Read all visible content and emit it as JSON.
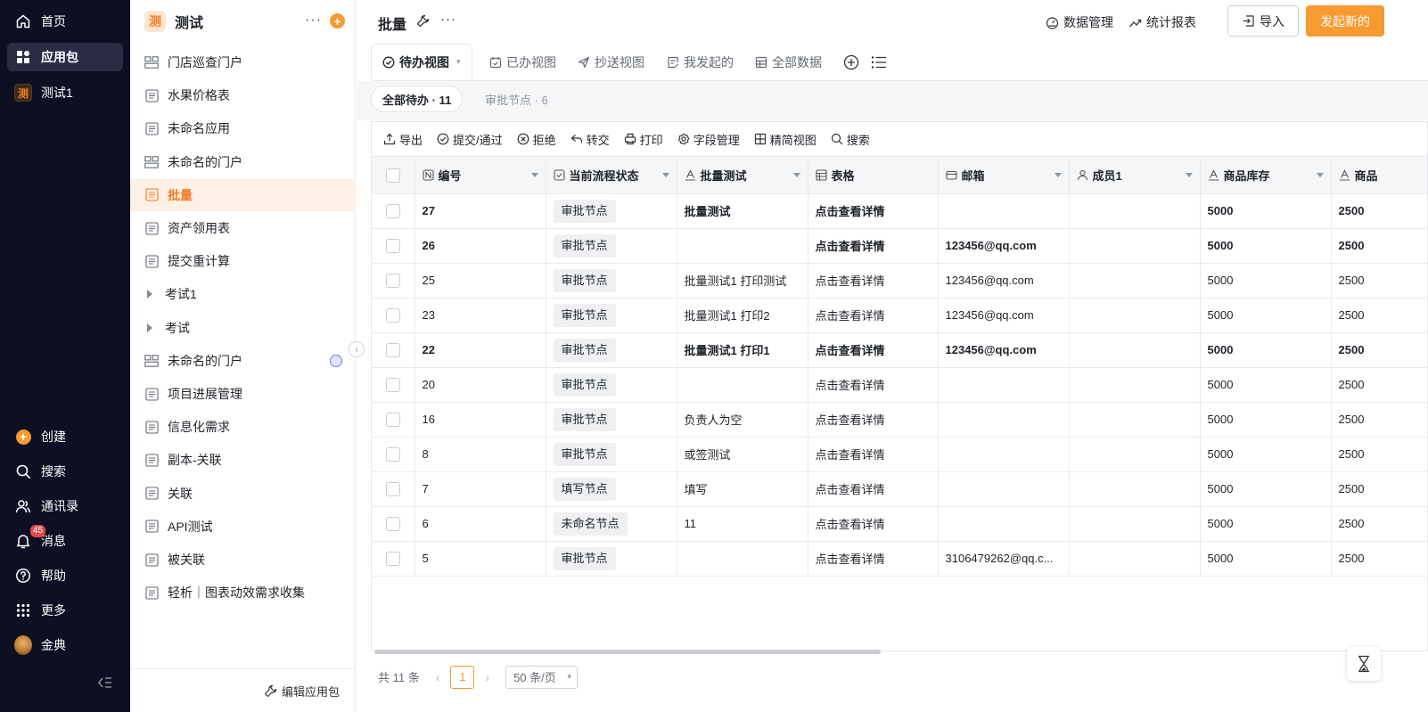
{
  "nav": {
    "top_items": [
      {
        "label": "首页",
        "icon": "home-icon"
      },
      {
        "label": "应用包",
        "icon": "grid-icon",
        "active": true
      },
      {
        "label": "测试1",
        "icon": "app-badge-icon",
        "badge_char": "测"
      }
    ],
    "bottom_items": [
      {
        "label": "创建",
        "icon": "plus-circle-icon"
      },
      {
        "label": "搜索",
        "icon": "search-icon"
      },
      {
        "label": "通讯录",
        "icon": "contacts-icon"
      },
      {
        "label": "消息",
        "icon": "bell-icon",
        "badge": "45"
      },
      {
        "label": "帮助",
        "icon": "help-icon"
      },
      {
        "label": "更多",
        "icon": "dots-grid-icon"
      },
      {
        "label": "金典",
        "icon": "avatar"
      }
    ]
  },
  "sidebar": {
    "logo_char": "测",
    "title": "测试",
    "more": "···",
    "plus": "+",
    "items": [
      {
        "label": "门店巡查门户",
        "icon": "portal-icon"
      },
      {
        "label": "水果价格表",
        "icon": "form-icon"
      },
      {
        "label": "未命名应用",
        "icon": "form-icon"
      },
      {
        "label": "未命名的门户",
        "icon": "portal-icon"
      },
      {
        "label": "批量",
        "icon": "form-icon",
        "active": true
      },
      {
        "label": "资产领用表",
        "icon": "form-icon"
      },
      {
        "label": "提交重计算",
        "icon": "form-icon"
      },
      {
        "label": "考试1",
        "icon": "folder-caret-icon"
      },
      {
        "label": "考试",
        "icon": "folder-caret-icon"
      },
      {
        "label": "未命名的门户",
        "icon": "portal-icon",
        "globe": true
      },
      {
        "label": "项目进展管理",
        "icon": "form-icon"
      },
      {
        "label": "信息化需求",
        "icon": "form-icon"
      },
      {
        "label": "副本-关联",
        "icon": "form-icon"
      },
      {
        "label": "关联",
        "icon": "form-icon"
      },
      {
        "label": "API测试",
        "icon": "form-icon"
      },
      {
        "label": "被关联",
        "icon": "form-icon"
      },
      {
        "label": "轻析｜图表动效需求收集",
        "icon": "form-icon"
      }
    ],
    "footer_label": "编辑应用包"
  },
  "header": {
    "title": "批量",
    "data_manage": "数据管理",
    "stats_report": "统计报表",
    "import_label": "导入",
    "new_label": "发起新的"
  },
  "view_tabs": [
    {
      "label": "待办视图",
      "active": true
    },
    {
      "label": "已办视图"
    },
    {
      "label": "抄送视图"
    },
    {
      "label": "我发起的"
    },
    {
      "label": "全部数据"
    }
  ],
  "sub_tabs": [
    {
      "label": "全部待办 · 11",
      "active": true
    },
    {
      "label": "审批节点 · 6"
    }
  ],
  "toolbar": [
    "导出",
    "提交/通过",
    "拒绝",
    "转交",
    "打印",
    "字段管理",
    "精简视图",
    "搜索"
  ],
  "table": {
    "columns": [
      "编号",
      "当前流程状态",
      "批量测试",
      "表格",
      "邮箱",
      "成员1",
      "商品库存",
      "商品"
    ],
    "rows": [
      {
        "bold": true,
        "cells": [
          "27",
          "审批节点",
          "批量测试",
          "点击查看详情",
          "",
          "",
          "5000",
          "2500"
        ]
      },
      {
        "bold": true,
        "cells": [
          "26",
          "审批节点",
          "",
          "点击查看详情",
          "123456@qq.com",
          "",
          "5000",
          "2500"
        ]
      },
      {
        "bold": false,
        "cells": [
          "25",
          "审批节点",
          "批量测试1 打印测试",
          "点击查看详情",
          "123456@qq.com",
          "",
          "5000",
          "2500"
        ]
      },
      {
        "bold": false,
        "cells": [
          "23",
          "审批节点",
          "批量测试1 打印2",
          "点击查看详情",
          "123456@qq.com",
          "",
          "5000",
          "2500"
        ]
      },
      {
        "bold": true,
        "cells": [
          "22",
          "审批节点",
          "批量测试1 打印1",
          "点击查看详情",
          "123456@qq.com",
          "",
          "5000",
          "2500"
        ]
      },
      {
        "bold": false,
        "cells": [
          "20",
          "审批节点",
          "",
          "点击查看详情",
          "",
          "",
          "5000",
          "2500"
        ]
      },
      {
        "bold": false,
        "cells": [
          "16",
          "审批节点",
          "负责人为空",
          "点击查看详情",
          "",
          "",
          "5000",
          "2500"
        ]
      },
      {
        "bold": false,
        "cells": [
          "8",
          "审批节点",
          "或签测试",
          "点击查看详情",
          "",
          "",
          "5000",
          "2500"
        ]
      },
      {
        "bold": false,
        "cells": [
          "7",
          "填写节点",
          "填写",
          "点击查看详情",
          "",
          "",
          "5000",
          "2500"
        ]
      },
      {
        "bold": false,
        "cells": [
          "6",
          "未命名节点",
          "11",
          "点击查看详情",
          "",
          "",
          "5000",
          "2500"
        ]
      },
      {
        "bold": false,
        "cells": [
          "5",
          "审批节点",
          "",
          "点击查看详情",
          "3106479262@qq.c...",
          "",
          "5000",
          "2500"
        ]
      }
    ]
  },
  "pager": {
    "total": "共 11 条",
    "page": "1",
    "per_page": "50 条/页"
  },
  "colors": {
    "accent": "#f79a30",
    "nav_bg": "#0d0f23",
    "active_row_bg": "#fdf0e4"
  }
}
